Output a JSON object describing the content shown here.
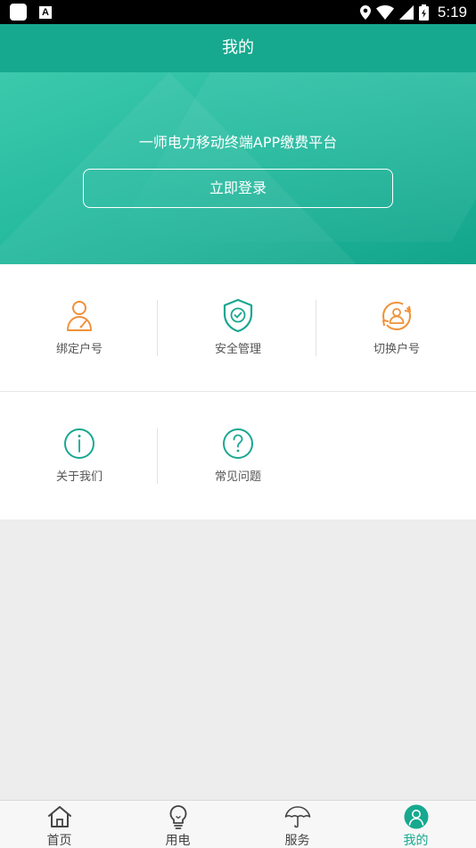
{
  "status_bar": {
    "time": "5:19"
  },
  "header": {
    "title": "我的"
  },
  "banner": {
    "title": "一师电力移动终端APP缴费平台",
    "login_label": "立即登录"
  },
  "menu": {
    "items": [
      {
        "label": "绑定户号",
        "icon": "user-bind-icon"
      },
      {
        "label": "安全管理",
        "icon": "shield-check-icon"
      },
      {
        "label": "切换户号",
        "icon": "switch-user-icon"
      },
      {
        "label": "关于我们",
        "icon": "info-icon"
      },
      {
        "label": "常见问题",
        "icon": "question-icon"
      }
    ]
  },
  "tabs": [
    {
      "label": "首页",
      "icon": "home-icon"
    },
    {
      "label": "用电",
      "icon": "bulb-icon"
    },
    {
      "label": "服务",
      "icon": "umbrella-icon"
    },
    {
      "label": "我的",
      "icon": "profile-icon",
      "active": true
    }
  ],
  "colors": {
    "primary": "#17a98f",
    "orange": "#f0913a",
    "teal": "#1aa791"
  }
}
